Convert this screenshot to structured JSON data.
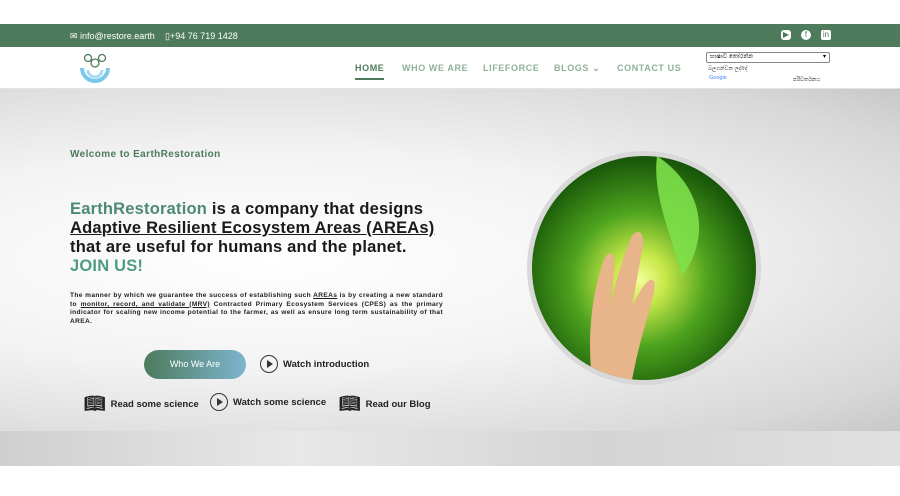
{
  "topbar": {
    "email": "info@restore.earth",
    "phone": "+94 76 719 1428",
    "social": [
      "youtube-icon",
      "facebook-icon",
      "linkedin-icon"
    ]
  },
  "nav": {
    "items": [
      "HOME",
      "WHO WE ARE",
      "LIFEFORCE",
      "BLOGS",
      "CONTACT US"
    ],
    "language_select": "භාෂාව තෝරන්න",
    "powered_by": "බලගන්වන ලද්දේ",
    "google": "Google",
    "translate": "පරිවර්තනය"
  },
  "hero": {
    "welcome": "Welcome to EarthRestoration",
    "headline": {
      "brand": "EarthRestoration",
      "p1": " is a company that designs ",
      "link": "Adaptive Resilient Ecosystem Areas (AREAs) ",
      "p2": "that are useful for humans and the planet. ",
      "cta": "JOIN US!"
    },
    "para": {
      "p1": "The manner by which we guarantee the success of establishing such ",
      "l1": "AREAs",
      "p2": " is by creating a new standard to ",
      "l2": "monitor, record, and validate (MRV)",
      "p3": " Contracted Primary Ecosystem Services (CPES) as the primary indicator for scaling new income potential to the farmer, as well as ensure long term sustainability of that AREA."
    },
    "who_button": "Who We Are",
    "watch_intro": "Watch introduction",
    "read_science": "Read some science",
    "watch_science": "Watch some science",
    "read_blog": "Read our Blog"
  }
}
